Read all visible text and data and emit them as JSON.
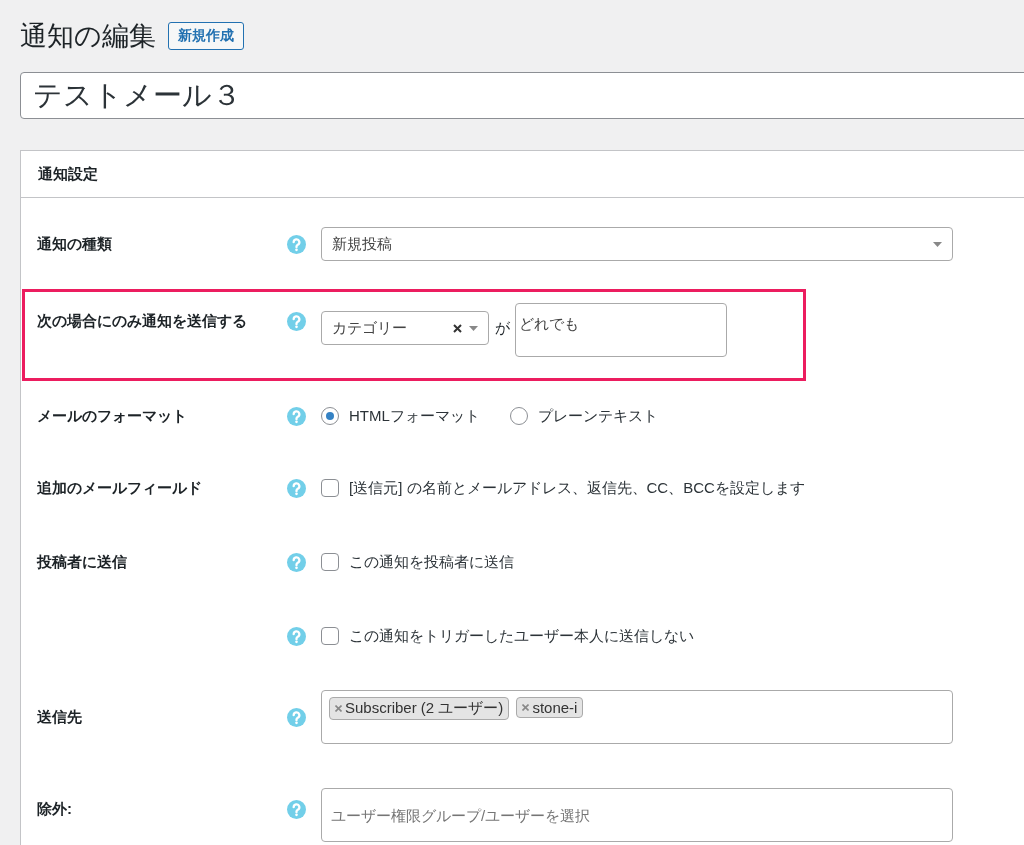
{
  "page": {
    "title": "通知の編集",
    "new_button": "新規作成"
  },
  "notification_title": "テストメール３",
  "panel": {
    "title": "通知設定",
    "rows": [
      {
        "kind": "select",
        "label": "通知の種類",
        "value": "新規投稿"
      },
      {
        "kind": "condition",
        "label": "次の場合にのみ通知を送信する",
        "highlighted": true,
        "field": "カテゴリー",
        "connector": "が",
        "value": "どれでも"
      },
      {
        "kind": "radio",
        "label": "メールのフォーマット",
        "options": [
          {
            "label": "HTMLフォーマット",
            "selected": true
          },
          {
            "label": "プレーンテキスト",
            "selected": false
          }
        ]
      },
      {
        "kind": "checkbox",
        "label": "追加のメールフィールド",
        "text": "[送信元] の名前とメールアドレス、返信先、CC、BCCを設定します",
        "checked": false
      },
      {
        "kind": "checkbox",
        "label": "投稿者に送信",
        "text": "この通知を投稿者に送信",
        "checked": false
      },
      {
        "kind": "checkbox",
        "text": "この通知をトリガーしたユーザー本人に送信しない",
        "checked": false
      },
      {
        "kind": "tags",
        "label": "送信先",
        "tags": [
          "Subscriber (2 ユーザー)",
          "stone-i"
        ]
      },
      {
        "kind": "search",
        "label": "除外:",
        "placeholder": "ユーザー権限グループ/ユーザーを選択"
      }
    ]
  }
}
